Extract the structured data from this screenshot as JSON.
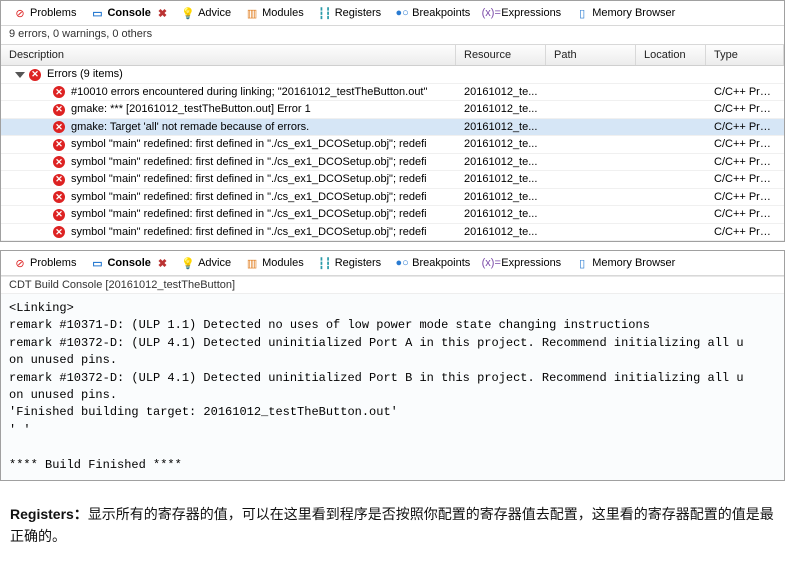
{
  "tabs": [
    {
      "id": "problems",
      "label": "Problems",
      "icon": "⊘",
      "cls": "ic-red"
    },
    {
      "id": "console",
      "label": "Console",
      "icon": "▭",
      "cls": "ic-blue",
      "badge": "✖"
    },
    {
      "id": "advice",
      "label": "Advice",
      "icon": "💡",
      "cls": "ic-yellow"
    },
    {
      "id": "modules",
      "label": "Modules",
      "icon": "▥",
      "cls": "ic-orange"
    },
    {
      "id": "registers",
      "label": "Registers",
      "icon": "┇┇",
      "cls": "ic-teal"
    },
    {
      "id": "breakpoints",
      "label": "Breakpoints",
      "icon": "●○",
      "cls": "ic-blue"
    },
    {
      "id": "expressions",
      "label": "Expressions",
      "icon": "(x)=",
      "cls": "ic-purple"
    },
    {
      "id": "memory",
      "label": "Memory Browser",
      "icon": "▯",
      "cls": "ic-blue"
    }
  ],
  "problems": {
    "summary": "9 errors, 0 warnings, 0 others",
    "columns": {
      "desc": "Description",
      "res": "Resource",
      "path": "Path",
      "loc": "Location",
      "type": "Type"
    },
    "group": {
      "label": "Errors (9 items)"
    },
    "items": [
      {
        "desc": "#10010 errors encountered during linking; \"20161012_testTheButton.out\"",
        "res": "20161012_te...",
        "type": "C/C++ Prob..."
      },
      {
        "desc": "gmake: *** [20161012_testTheButton.out] Error 1",
        "res": "20161012_te...",
        "type": "C/C++ Prob..."
      },
      {
        "desc": "gmake: Target 'all' not remade because of errors.",
        "res": "20161012_te...",
        "type": "C/C++ Prob...",
        "selected": true
      },
      {
        "desc": "symbol \"main\" redefined: first defined in \"./cs_ex1_DCOSetup.obj\"; redefi",
        "res": "20161012_te...",
        "type": "C/C++ Prob..."
      },
      {
        "desc": "symbol \"main\" redefined: first defined in \"./cs_ex1_DCOSetup.obj\"; redefi",
        "res": "20161012_te...",
        "type": "C/C++ Prob..."
      },
      {
        "desc": "symbol \"main\" redefined: first defined in \"./cs_ex1_DCOSetup.obj\"; redefi",
        "res": "20161012_te...",
        "type": "C/C++ Prob..."
      },
      {
        "desc": "symbol \"main\" redefined: first defined in \"./cs_ex1_DCOSetup.obj\"; redefi",
        "res": "20161012_te...",
        "type": "C/C++ Prob..."
      },
      {
        "desc": "symbol \"main\" redefined: first defined in \"./cs_ex1_DCOSetup.obj\"; redefi",
        "res": "20161012_te...",
        "type": "C/C++ Prob..."
      },
      {
        "desc": "symbol \"main\" redefined: first defined in \"./cs_ex1_DCOSetup.obj\"; redefi",
        "res": "20161012_te...",
        "type": "C/C++ Prob..."
      }
    ]
  },
  "console": {
    "header": "CDT Build Console [20161012_testTheButton]",
    "text": "<Linking>\nremark #10371-D: (ULP 1.1) Detected no uses of low power mode state changing instructions\nremark #10372-D: (ULP 4.1) Detected uninitialized Port A in this project. Recommend initializing all u\non unused pins.\nremark #10372-D: (ULP 4.1) Detected uninitialized Port B in this project. Recommend initializing all u\non unused pins.\n'Finished building target: 20161012_testTheButton.out'\n' '\n\n**** Build Finished ****\n"
  },
  "doc": {
    "label": "Registers：",
    "body": "显示所有的寄存器的值，可以在这里看到程序是否按照你配置的寄存器值去配置，这里看的寄存器配置的值是最正确的。"
  }
}
